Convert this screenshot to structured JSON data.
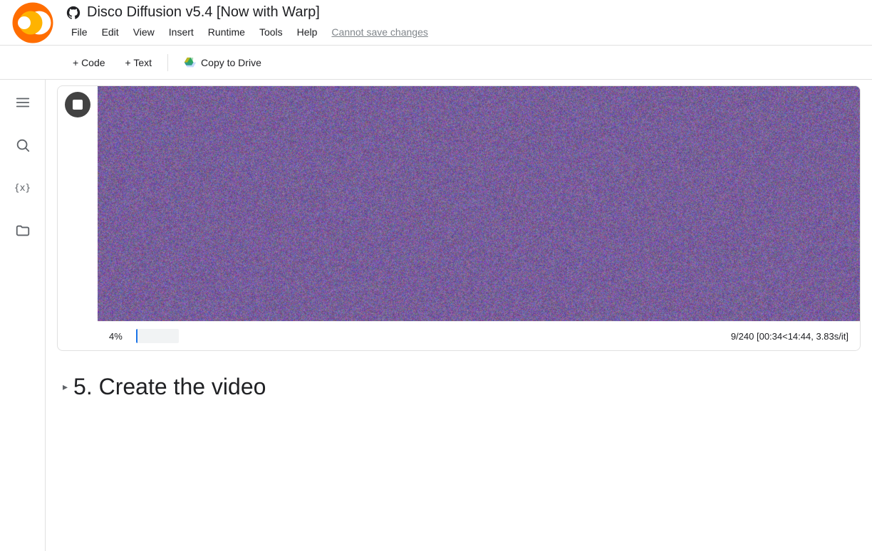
{
  "app": {
    "logo_text": "CO",
    "title": "Disco Diffusion v5.4 [Now with Warp]",
    "cannot_save": "Cannot save changes"
  },
  "menu": {
    "items": [
      "File",
      "Edit",
      "View",
      "Insert",
      "Runtime",
      "Tools",
      "Help"
    ]
  },
  "toolbar": {
    "add_code": "+ Code",
    "add_text": "+ Text",
    "copy_to_drive": "Copy to Drive"
  },
  "sidebar": {
    "icons": [
      "menu",
      "search",
      "variable",
      "folder"
    ]
  },
  "cell": {
    "progress_percent": "4%",
    "progress_stats": "9/240 [00:34<14:44, 3.83s/it]",
    "progress_value": 4
  },
  "section": {
    "title": "5. Create the video",
    "collapse_char": "▸"
  }
}
